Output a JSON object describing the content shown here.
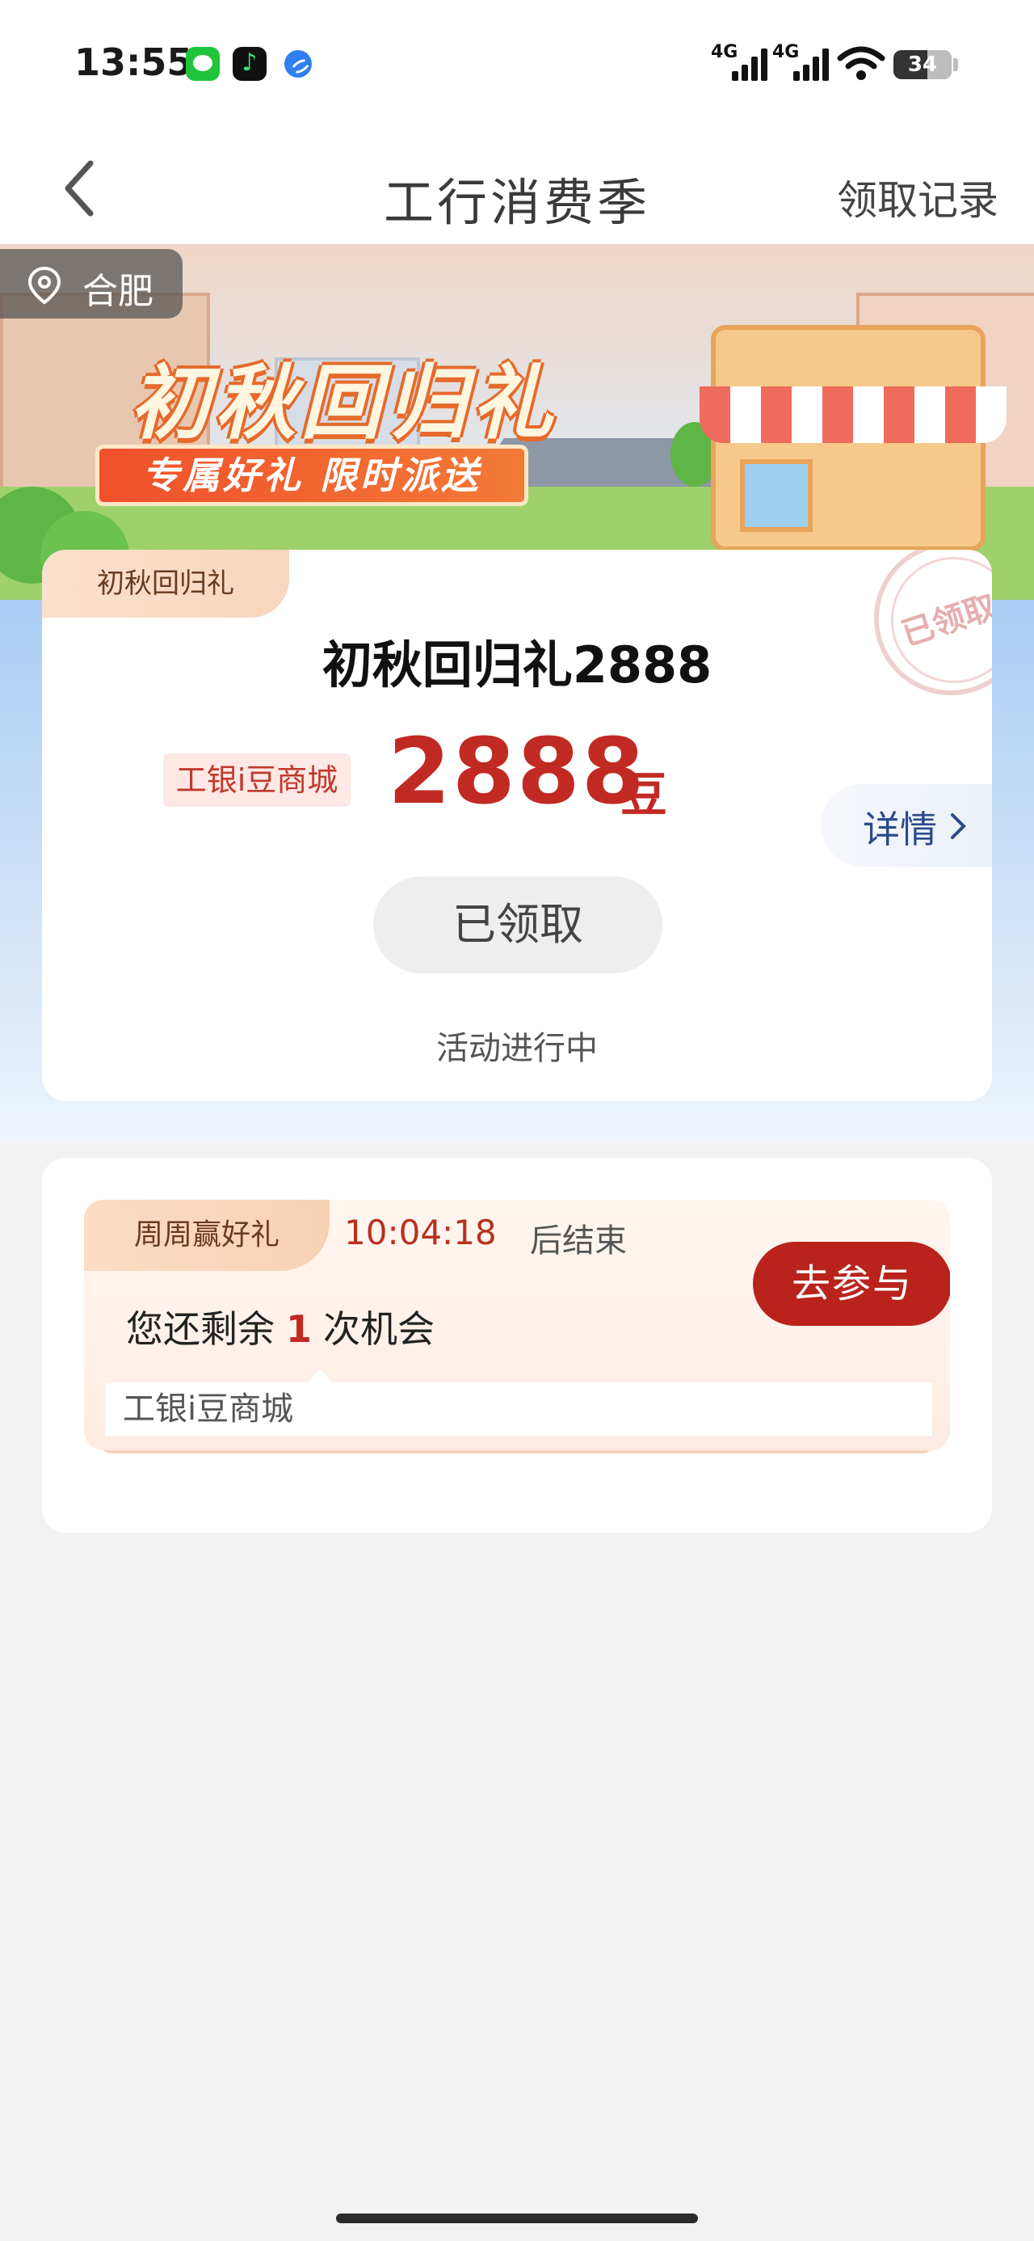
{
  "status_bar": {
    "time": "13:55",
    "signal1_label": "4G",
    "signal2_label": "4G",
    "battery": "34"
  },
  "nav": {
    "title": "工行消费季",
    "records_label": "领取记录"
  },
  "banner": {
    "title": "初秋回归礼",
    "subtitle": "专属好礼 限时派送",
    "location": "合肥"
  },
  "reward_card": {
    "tag": "初秋回归礼",
    "title": "初秋回归礼2888",
    "mall": "工银i豆商城",
    "amount": "2888",
    "unit": "豆",
    "details_label": "详情",
    "claimed_label": "已领取",
    "status": "活动进行中",
    "stamp": "已领取"
  },
  "task_card": {
    "tag": "周周赢好礼",
    "countdown": "10:04:18",
    "countdown_suffix": "后结束",
    "chances_prefix": "您还剩余",
    "chances_count": "1",
    "chances_suffix": "次机会",
    "join_label": "去参与",
    "footer": "工银i豆商城"
  },
  "colors": {
    "accent_red": "#c12a23",
    "button_red": "#b9231c",
    "link_blue": "#2b4a8a"
  }
}
